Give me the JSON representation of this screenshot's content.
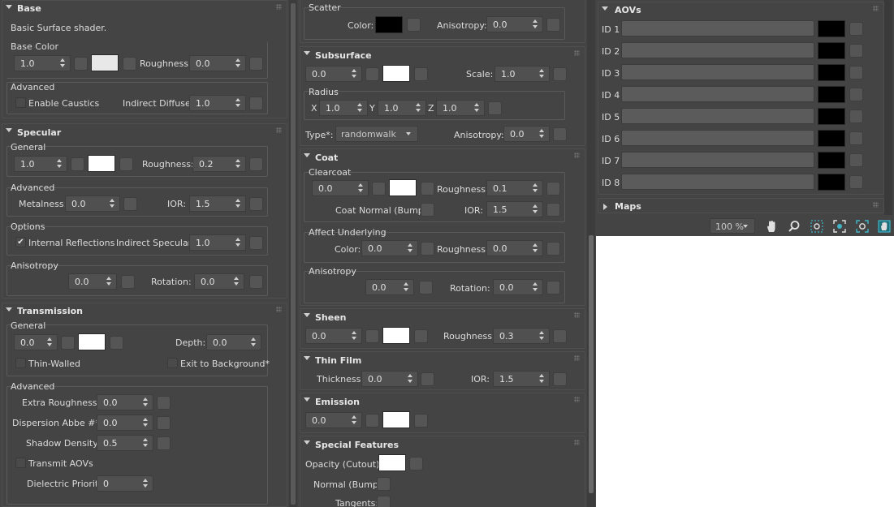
{
  "left": {
    "base": {
      "title": "Base",
      "description": "Basic Surface shader.",
      "base_color_label": "Base Color",
      "weight": "1.0",
      "roughness_label": "Roughness:",
      "roughness": "0.0",
      "advanced_label": "Advanced",
      "enable_caustics": "Enable Caustics",
      "indirect_diffuse_label": "Indirect Diffuse:",
      "indirect_diffuse": "1.0",
      "color": "#e8e8e8"
    },
    "specular": {
      "title": "Specular",
      "general_label": "General",
      "weight": "1.0",
      "roughness_label": "Roughness:",
      "roughness": "0.2",
      "advanced_label": "Advanced",
      "metalness_label": "Metalness:",
      "metalness": "0.0",
      "ior_label": "IOR:",
      "ior": "1.5",
      "options_label": "Options",
      "internal_reflections": "Internal Reflections",
      "indirect_specular_label": "Indirect Specular:",
      "indirect_specular": "1.0",
      "anisotropy_label": "Anisotropy",
      "anisotropy": "0.0",
      "rotation_label": "Rotation:",
      "rotation": "0.0"
    },
    "transmission": {
      "title": "Transmission",
      "general_label": "General",
      "weight": "0.0",
      "depth_label": "Depth:",
      "depth": "0.0",
      "thin_walled": "Thin-Walled",
      "exit_to_background": "Exit to Background*",
      "advanced_label": "Advanced",
      "extra_roughness_label": "Extra Roughness:",
      "extra_roughness": "0.0",
      "dispersion_label": "Dispersion Abbe #*:",
      "dispersion": "0.0",
      "shadow_density_label": "Shadow Density:",
      "shadow_density": "0.5",
      "transmit_aovs": "Transmit AOVs",
      "dielectric_priority_label": "Dielectric Priority",
      "dielectric_priority": "0"
    }
  },
  "middle": {
    "scatter": {
      "label": "Scatter",
      "color_label": "Color:",
      "anisotropy_label": "Anisotropy:",
      "anisotropy": "0.0"
    },
    "subsurface": {
      "title": "Subsurface",
      "weight": "0.0",
      "scale_label": "Scale:",
      "scale": "1.0",
      "radius_label": "Radius",
      "x_label": "X",
      "x": "1.0",
      "y_label": "Y",
      "y": "1.0",
      "z_label": "Z",
      "z": "1.0",
      "type_label": "Type*:",
      "type_value": "randomwalk",
      "anisotropy_label": "Anisotropy:",
      "anisotropy": "0.0"
    },
    "coat": {
      "title": "Coat",
      "clearcoat_label": "Clearcoat",
      "weight": "0.0",
      "roughness_label": "Roughness:",
      "roughness": "0.1",
      "coat_normal_label": "Coat Normal (Bump):",
      "ior_label": "IOR:",
      "ior": "1.5",
      "affect_label": "Affect Underlying",
      "color_label": "Color:",
      "affect_color": "0.0",
      "affect_roughness_label": "Roughness:",
      "affect_roughness": "0.0",
      "anisotropy_label": "Anisotropy",
      "anisotropy": "0.0",
      "rotation_label": "Rotation:",
      "rotation": "0.0"
    },
    "sheen": {
      "title": "Sheen",
      "weight": "0.0",
      "roughness_label": "Roughness:",
      "roughness": "0.3"
    },
    "thin_film": {
      "title": "Thin Film",
      "thickness_label": "Thickness:",
      "thickness": "0.0",
      "ior_label": "IOR:",
      "ior": "1.5"
    },
    "emission": {
      "title": "Emission",
      "weight": "0.0"
    },
    "special": {
      "title": "Special Features",
      "opacity_label": "Opacity (Cutout):",
      "normal_label": "Normal (Bump):",
      "tangents_label": "Tangents:"
    }
  },
  "right": {
    "aovs_title": "AOVs",
    "aov_ids": [
      "ID 1",
      "ID 2",
      "ID 3",
      "ID 4",
      "ID 5",
      "ID 6",
      "ID 7",
      "ID 8"
    ],
    "maps_title": "Maps",
    "zoom": "100 %"
  }
}
